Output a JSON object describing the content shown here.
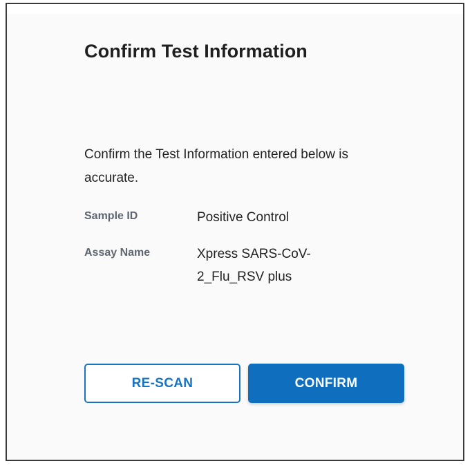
{
  "dialog": {
    "title": "Confirm Test Information",
    "instruction": "Confirm the Test Information entered below is accurate.",
    "fields": [
      {
        "label": "Sample ID",
        "value": "Positive Control"
      },
      {
        "label": "Assay Name",
        "value": "Xpress SARS-CoV-2_Flu_RSV plus"
      }
    ],
    "buttons": {
      "rescan_label": "RE-SCAN",
      "confirm_label": "CONFIRM"
    }
  },
  "colors": {
    "accent": "#0f6ebd",
    "label_gray": "#5e6670",
    "panel_background": "#fafafa"
  }
}
